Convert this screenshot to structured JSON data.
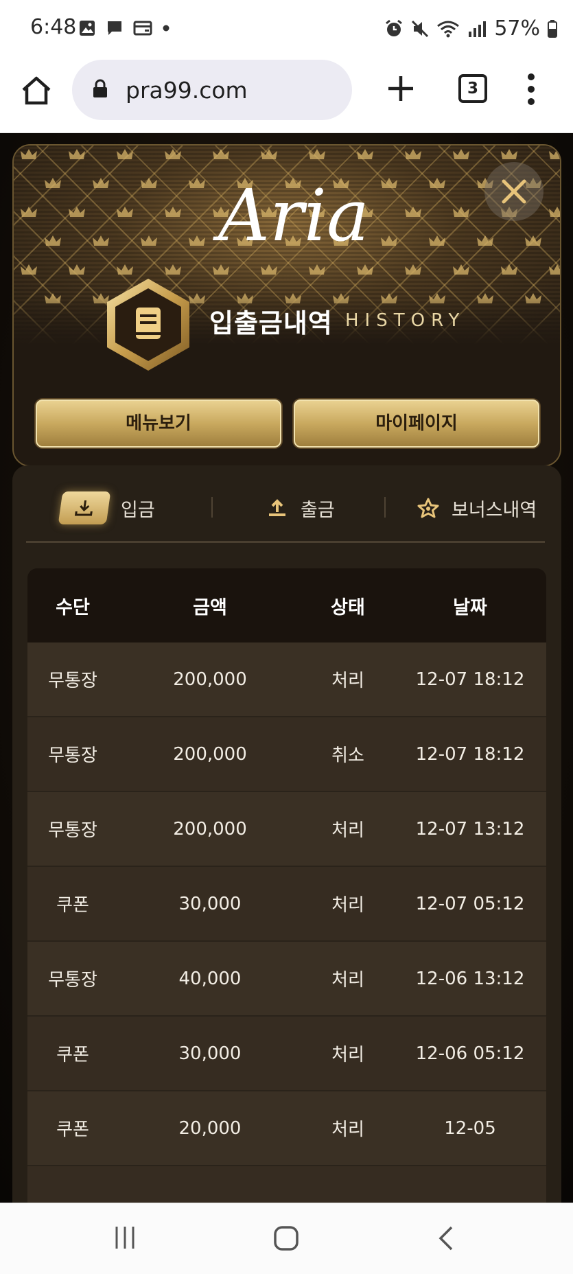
{
  "status_bar": {
    "time": "6:48",
    "battery": "57%"
  },
  "browser": {
    "url": "pra99.com",
    "tab_count": "3"
  },
  "header": {
    "logo_text": "Aria",
    "title_ko": "입출금내역",
    "title_en": "HISTORY",
    "buttons": {
      "menu": "메뉴보기",
      "mypage": "마이페이지"
    }
  },
  "tabs": [
    {
      "label": "입금",
      "icon": "download-icon",
      "active": true
    },
    {
      "label": "출금",
      "icon": "upload-icon",
      "active": false
    },
    {
      "label": "보너스내역",
      "icon": "star-icon",
      "active": false
    }
  ],
  "table": {
    "headers": [
      "수단",
      "금액",
      "상태",
      "날짜"
    ],
    "rows": [
      [
        "무통장",
        "200,000",
        "처리",
        "12-07 18:12"
      ],
      [
        "무통장",
        "200,000",
        "취소",
        "12-07 18:12"
      ],
      [
        "무통장",
        "200,000",
        "처리",
        "12-07 13:12"
      ],
      [
        "쿠폰",
        "30,000",
        "처리",
        "12-07 05:12"
      ],
      [
        "무통장",
        "40,000",
        "처리",
        "12-06 13:12"
      ],
      [
        "쿠폰",
        "30,000",
        "처리",
        "12-06 05:12"
      ],
      [
        "쿠폰",
        "20,000",
        "처리",
        "12-05"
      ]
    ]
  },
  "colors": {
    "gold": "#c9a95f",
    "chat_button": "#1407f0",
    "background": "#120d08"
  }
}
